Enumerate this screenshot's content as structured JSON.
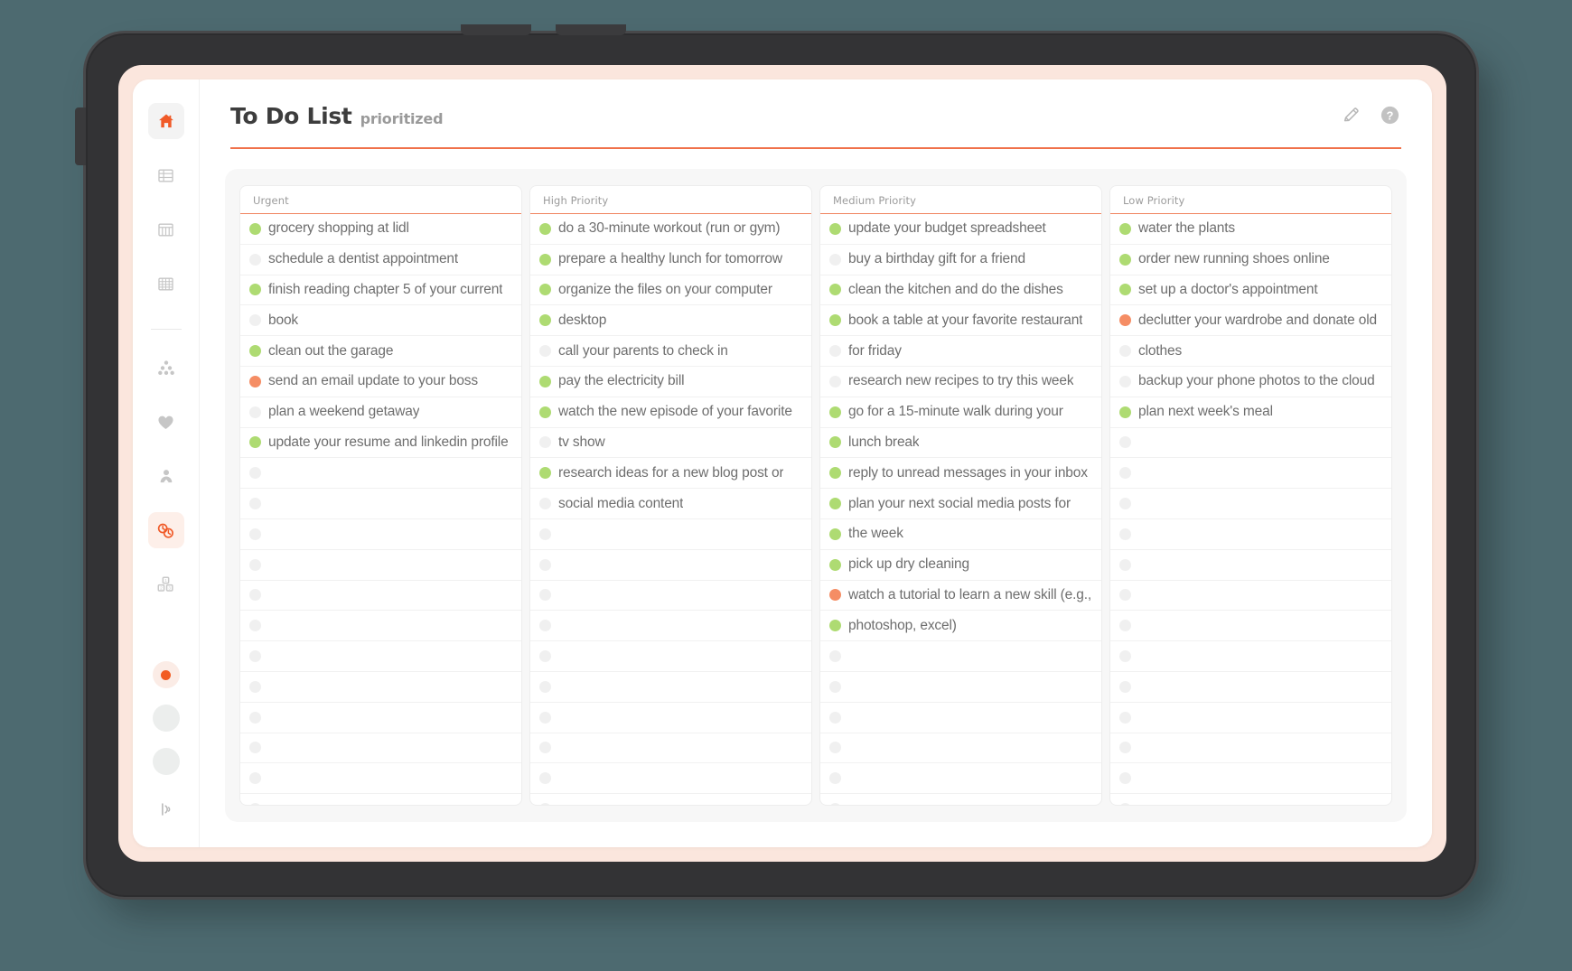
{
  "header": {
    "title": "To Do List",
    "subtitle": "prioritized",
    "actions": [
      {
        "name": "edit-pencil-icon",
        "label": "Edit"
      },
      {
        "name": "help-icon",
        "label": "Help"
      }
    ]
  },
  "sidebar": {
    "items": [
      {
        "name": "home-icon",
        "label": "Home",
        "state": "active"
      },
      {
        "name": "list-view-icon",
        "label": "List view",
        "state": "default"
      },
      {
        "name": "table-view-icon",
        "label": "Table view",
        "state": "default"
      },
      {
        "name": "grid-view-icon",
        "label": "Grid view",
        "state": "default"
      },
      {
        "name": "hierarchy-icon",
        "label": "Hierarchy",
        "state": "default"
      },
      {
        "name": "favorites-heart-icon",
        "label": "Favorites",
        "state": "default"
      },
      {
        "name": "contacts-icon",
        "label": "Contacts",
        "state": "default"
      },
      {
        "name": "history-clock-icon",
        "label": "History",
        "state": "active-soft"
      },
      {
        "name": "blocks-icon",
        "label": "Blocks",
        "state": "default"
      }
    ],
    "bottom_dots": [
      {
        "name": "status-dot-selected",
        "state": "selected"
      },
      {
        "name": "status-dot-idle",
        "state": "idle"
      },
      {
        "name": "status-dot-idle-2",
        "state": "idle"
      }
    ],
    "bottom_icon": {
      "name": "toggle-power-icon",
      "label": "Toggle"
    }
  },
  "board": {
    "row_count": 20,
    "colors": {
      "green": "#aedb72",
      "orange": "#f58d64",
      "empty": "#f0f0f0",
      "accent": "#f0714a"
    },
    "columns": [
      {
        "title": "Urgent",
        "rows": [
          {
            "status": "green",
            "text": "grocery shopping at lidl"
          },
          {
            "status": "empty",
            "text": "schedule a dentist appointment"
          },
          {
            "status": "green",
            "text": "finish reading chapter 5 of your current"
          },
          {
            "status": "empty",
            "text": "book"
          },
          {
            "status": "green",
            "text": "clean out the garage"
          },
          {
            "status": "orange",
            "text": "send an email update to your boss"
          },
          {
            "status": "empty",
            "text": "plan a weekend getaway"
          },
          {
            "status": "green",
            "text": "update your resume and linkedin profile"
          }
        ]
      },
      {
        "title": "High Priority",
        "rows": [
          {
            "status": "green",
            "text": "do a 30-minute workout (run or gym)"
          },
          {
            "status": "green",
            "text": "prepare a healthy lunch for tomorrow"
          },
          {
            "status": "green",
            "text": "organize the files on your computer"
          },
          {
            "status": "green",
            "text": "desktop"
          },
          {
            "status": "empty",
            "text": "call your parents to check in"
          },
          {
            "status": "green",
            "text": "pay the electricity bill"
          },
          {
            "status": "green",
            "text": "watch the new episode of your favorite"
          },
          {
            "status": "empty",
            "text": "tv show"
          },
          {
            "status": "green",
            "text": "research ideas for a new blog post or"
          },
          {
            "status": "empty",
            "text": "social media content"
          }
        ]
      },
      {
        "title": "Medium Priority",
        "rows": [
          {
            "status": "green",
            "text": "update your budget spreadsheet"
          },
          {
            "status": "empty",
            "text": "buy a birthday gift for a friend"
          },
          {
            "status": "green",
            "text": "clean the kitchen and do the dishes"
          },
          {
            "status": "green",
            "text": "book a table at your favorite restaurant"
          },
          {
            "status": "empty",
            "text": "for friday"
          },
          {
            "status": "empty",
            "text": "research new recipes to try this week"
          },
          {
            "status": "green",
            "text": "go for a 15-minute walk during your"
          },
          {
            "status": "green",
            "text": "lunch break"
          },
          {
            "status": "green",
            "text": "reply to unread messages in your inbox"
          },
          {
            "status": "green",
            "text": "plan your next social media posts for"
          },
          {
            "status": "green",
            "text": "the week"
          },
          {
            "status": "green",
            "text": "pick up dry cleaning"
          },
          {
            "status": "orange",
            "text": "watch a tutorial to learn a new skill (e.g.,"
          },
          {
            "status": "green",
            "text": "photoshop, excel)"
          }
        ]
      },
      {
        "title": "Low Priority",
        "rows": [
          {
            "status": "green",
            "text": "water the plants"
          },
          {
            "status": "green",
            "text": "order new running shoes online"
          },
          {
            "status": "green",
            "text": "set up a doctor's appointment"
          },
          {
            "status": "orange",
            "text": "declutter your wardrobe and donate old"
          },
          {
            "status": "empty",
            "text": "clothes"
          },
          {
            "status": "empty",
            "text": "backup your phone photos to the cloud"
          },
          {
            "status": "green",
            "text": "plan next week's meal"
          }
        ]
      }
    ]
  }
}
